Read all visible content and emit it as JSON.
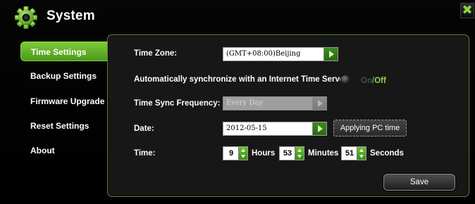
{
  "header": {
    "title": "System",
    "close_label": "✖"
  },
  "colors": {
    "accent": "#6cbf2f",
    "panel_border": "#5f8a36",
    "off_text": "#8ad44a"
  },
  "sidebar": {
    "items": [
      {
        "label": "Time Settings",
        "active": true
      },
      {
        "label": "Backup Settings",
        "active": false
      },
      {
        "label": "Firmware Upgrade",
        "active": false
      },
      {
        "label": "Reset Settings",
        "active": false
      },
      {
        "label": "About",
        "active": false
      }
    ]
  },
  "form": {
    "time_zone_label": "Time Zone:",
    "time_zone_value": "(GMT+08:00)Beijing",
    "auto_sync_label": "Automatically synchronize with an Internet Time Server:",
    "auto_sync_on": "On",
    "auto_sync_sep": "/",
    "auto_sync_off": "Off",
    "sync_freq_label": "Time Sync Frequency:",
    "sync_freq_value": "Every Day",
    "date_label": "Date:",
    "date_value": "2012-05-15",
    "apply_pc_time_label": "Applying PC time",
    "time_label": "Time:",
    "hours_value": "9",
    "hours_unit": "Hours",
    "minutes_value": "53",
    "minutes_unit": "Minutes",
    "seconds_value": "51",
    "seconds_unit": "Seconds",
    "save_label": "Save"
  }
}
